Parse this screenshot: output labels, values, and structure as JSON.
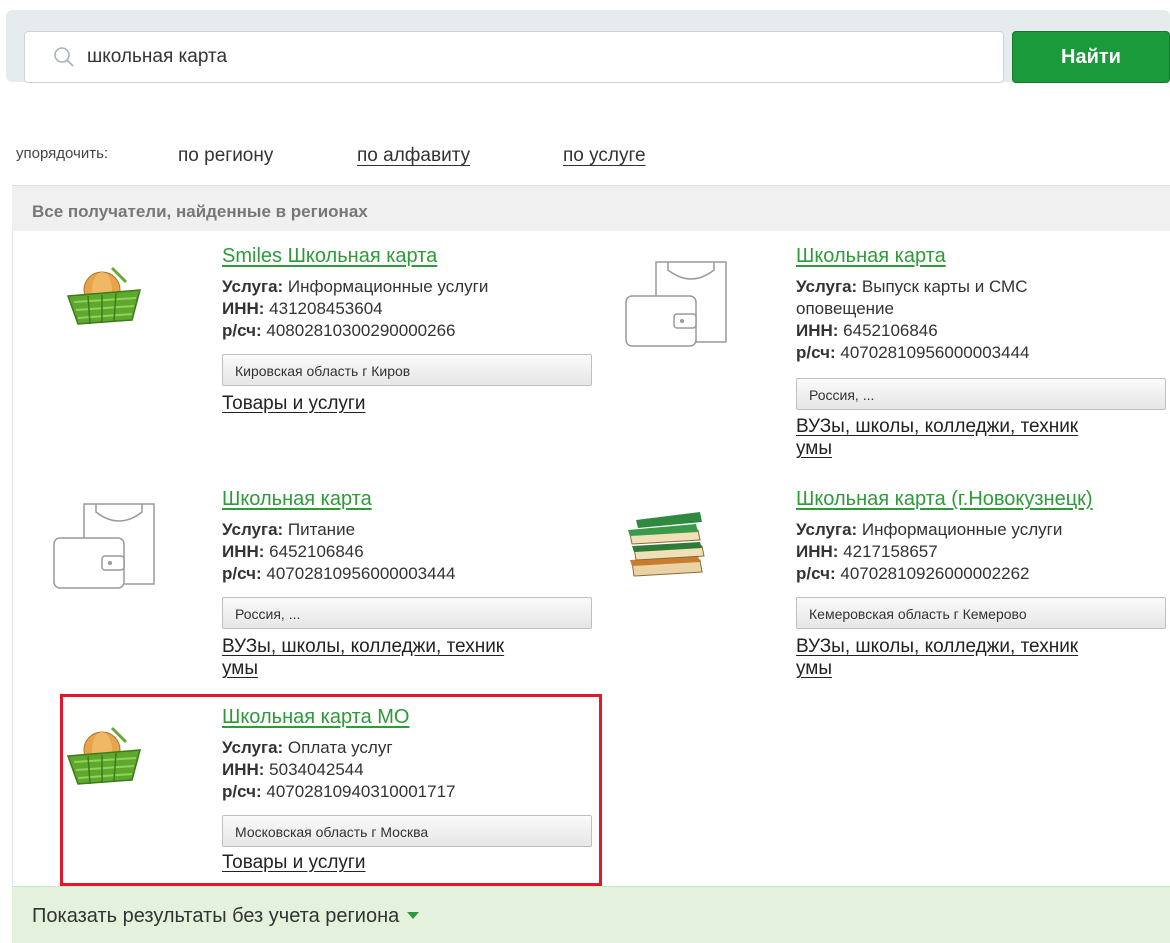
{
  "search": {
    "query": "школьная карта",
    "button_label": "Найти"
  },
  "sort": {
    "label": "упорядочить:",
    "options": [
      "по региону",
      "по алфавиту",
      "по услуге"
    ]
  },
  "results_header": "Все получатели, найденные в регионах",
  "labels": {
    "service": "Услуга:",
    "inn": "ИНН:",
    "account": "р/сч:"
  },
  "results": [
    {
      "icon": "basket-icon",
      "title": "Smiles Школьная карта",
      "service": "Информационные услуги",
      "inn": "431208453604",
      "account": "40802810300290000266",
      "region": "Кировская область г Киров",
      "category": "Товары и услуги"
    },
    {
      "icon": "wallet-icon",
      "title": "Школьная карта",
      "service_line1": "Выпуск карты и СМС",
      "service_line2": "оповещение",
      "inn": "6452106846",
      "account": "40702810956000003444",
      "region": "Россия, ...",
      "category_line1": "ВУЗы, школы, колледжи, техник",
      "category_line2": "умы"
    },
    {
      "icon": "wallet-icon",
      "title": "Школьная карта",
      "service": "Питание",
      "inn": "6452106846",
      "account": "40702810956000003444",
      "region": "Россия, ...",
      "category_line1": "ВУЗы, школы, колледжи, техник",
      "category_line2": "умы"
    },
    {
      "icon": "books-icon",
      "title": "Школьная карта (г.Новокузнецк)",
      "service": "Информационные услуги",
      "inn": "4217158657",
      "account": "40702810926000002262",
      "region": "Кемеровская область г Кемерово",
      "category_line1": "ВУЗы, школы, колледжи, техник",
      "category_line2": "умы"
    },
    {
      "icon": "basket-icon",
      "title": "Школьная карта МО",
      "service": "Оплата услуг",
      "inn": "5034042544",
      "account": "40702810940310001717",
      "region": "Московская область г Москва",
      "category": "Товары и услуги"
    }
  ],
  "footer": {
    "label": "Показать результаты без учета региона"
  },
  "colors": {
    "accent_green": "#1a9a3a",
    "link_green": "#2e9a3a",
    "highlight_red": "#e3162a"
  }
}
